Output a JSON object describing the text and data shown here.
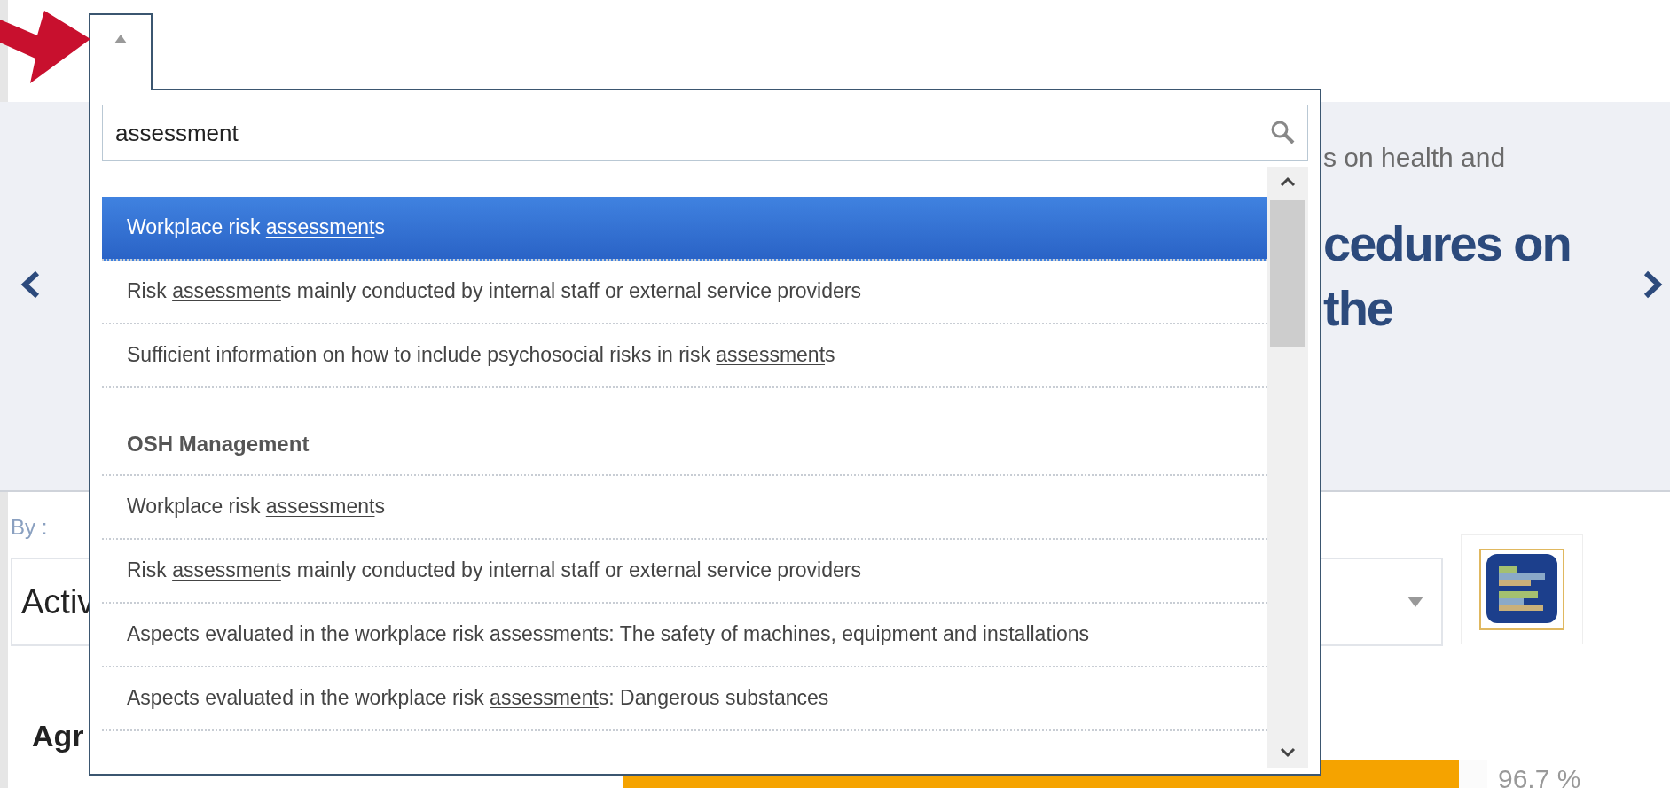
{
  "hero": {
    "subtitle": "s on health and",
    "title_lines": [
      "cedures on",
      "the"
    ]
  },
  "filter": {
    "label": "By :",
    "value": "Activ"
  },
  "section_title": "Agr",
  "bar": {
    "level": 0.967,
    "value_label": "96.7 %"
  },
  "dropdown": {
    "open": true,
    "search": {
      "value": "assessment"
    },
    "groups": [
      {
        "items": [
          {
            "before": "Workplace risk ",
            "match": "assessment",
            "after": "s",
            "selected": true
          },
          {
            "before": "Risk ",
            "match": "assessment",
            "after": "s mainly conducted by internal staff or external service providers",
            "selected": false
          },
          {
            "before": "Sufficient information on how to include psychosocial risks in risk ",
            "match": "assessment",
            "after": "s",
            "selected": false
          }
        ]
      },
      {
        "title": "OSH Management",
        "items": [
          {
            "before": "Workplace risk ",
            "match": "assessment",
            "after": "s",
            "selected": false
          },
          {
            "before": "Risk ",
            "match": "assessment",
            "after": "s mainly conducted by internal staff or external service providers",
            "selected": false
          },
          {
            "before": "Aspects evaluated in the workplace risk ",
            "match": "assessment",
            "after": "s: The safety of machines, equipment and installations",
            "selected": false
          },
          {
            "before": "Aspects evaluated in the workplace risk ",
            "match": "assessment",
            "after": "s: Dangerous substances",
            "selected": false
          }
        ]
      }
    ]
  }
}
